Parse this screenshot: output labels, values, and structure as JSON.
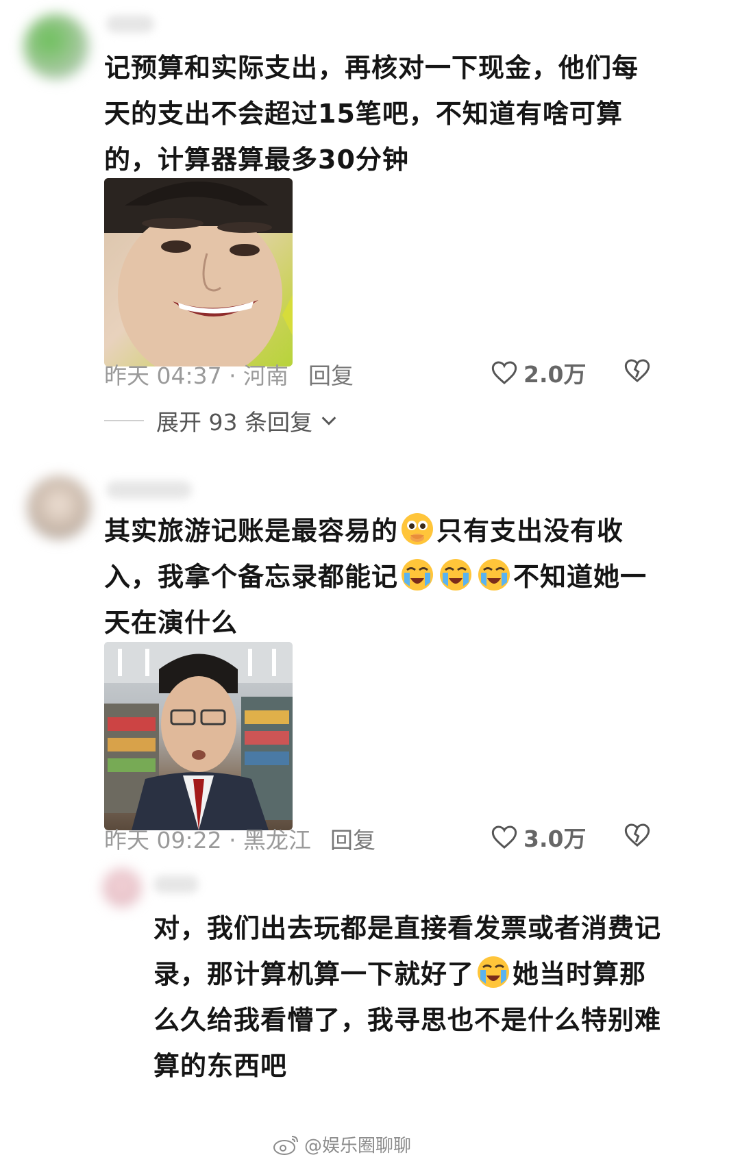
{
  "comments": [
    {
      "text_lines": [
        "记预算和实际支出，再核对一下现金，他们每",
        "天的支出不会超过15笔吧，不知道有啥可算",
        "的，计算器算最多30分钟"
      ],
      "meta": "昨天 04:37 · 河南",
      "reply_label": "回复",
      "likes": "2.0万",
      "expand_label": "展开 93 条回复"
    },
    {
      "text_line1a": "其实旅游记账是最容易的",
      "text_line1b": "只有支出没有收",
      "text_line2a": "入，我拿个备忘录都能记",
      "text_line2b": "不知道她一",
      "text_line3": "天在演什么",
      "meta": "昨天 09:22 · 黑龙江",
      "reply_label": "回复",
      "likes": "3.0万"
    },
    {
      "text_line1": "对，我们出去玩都是直接看发票或者消费记",
      "text_line2a": "录，那计算机算一下就好了",
      "text_line2b": "她当时算那",
      "text_line3": "么久给我看懵了，我寻思也不是什么特别难",
      "text_line4": "算的东西吧"
    }
  ],
  "watermark": "@娱乐圈聊聊",
  "colors": {
    "background": "#ffffff",
    "text": "#151515",
    "meta": "#9a9a9a"
  },
  "icons": [
    "heart-icon",
    "broken-heart-icon",
    "chevron-down-icon",
    "crying-emoji-icon",
    "pleading-emoji-icon",
    "weibo-logo-icon"
  ]
}
